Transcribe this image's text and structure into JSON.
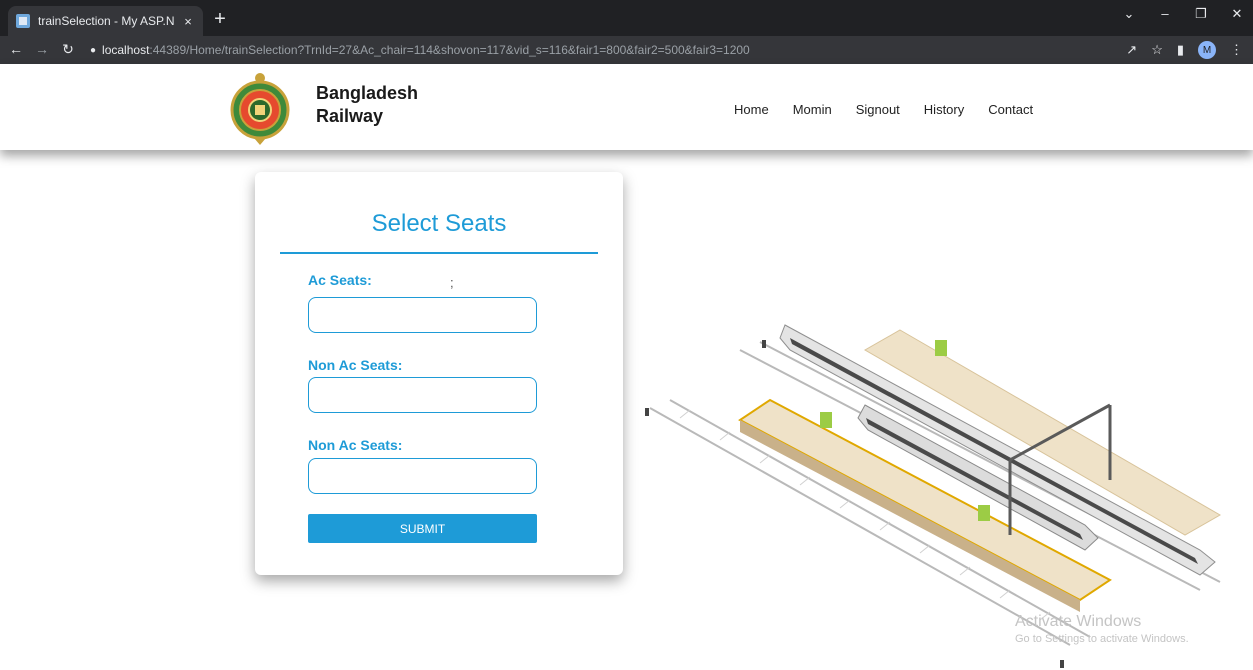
{
  "browser": {
    "tab_title": "trainSelection - My ASP.NET App",
    "tab_close": "×",
    "new_tab": "+",
    "url_host": "localhost",
    "url_rest": ":44389/Home/trainSelection?TrnId=27&Ac_chair=114&shovon=117&vid_s=116&fair1=800&fair2=500&fair3=1200",
    "profile_initial": "M"
  },
  "header": {
    "brand_line1": "Bangladesh",
    "brand_line2": "Railway",
    "nav": [
      "Home",
      "Momin",
      "Signout",
      "History",
      "Contact"
    ]
  },
  "form": {
    "title": "Select Seats",
    "label1": "Ac Seats:",
    "separator": ";",
    "label2": "Non Ac Seats:",
    "label3": "Non Ac Seats:",
    "input1_value": "",
    "input2_value": "",
    "input3_value": "",
    "submit_label": "SUBMIT"
  },
  "watermark": {
    "title": "Activate Windows",
    "subtitle": "Go to Settings to activate Windows."
  },
  "colors": {
    "accent": "#1e9bd7",
    "browser_dark": "#202124",
    "browser_toolbar": "#35363a"
  }
}
